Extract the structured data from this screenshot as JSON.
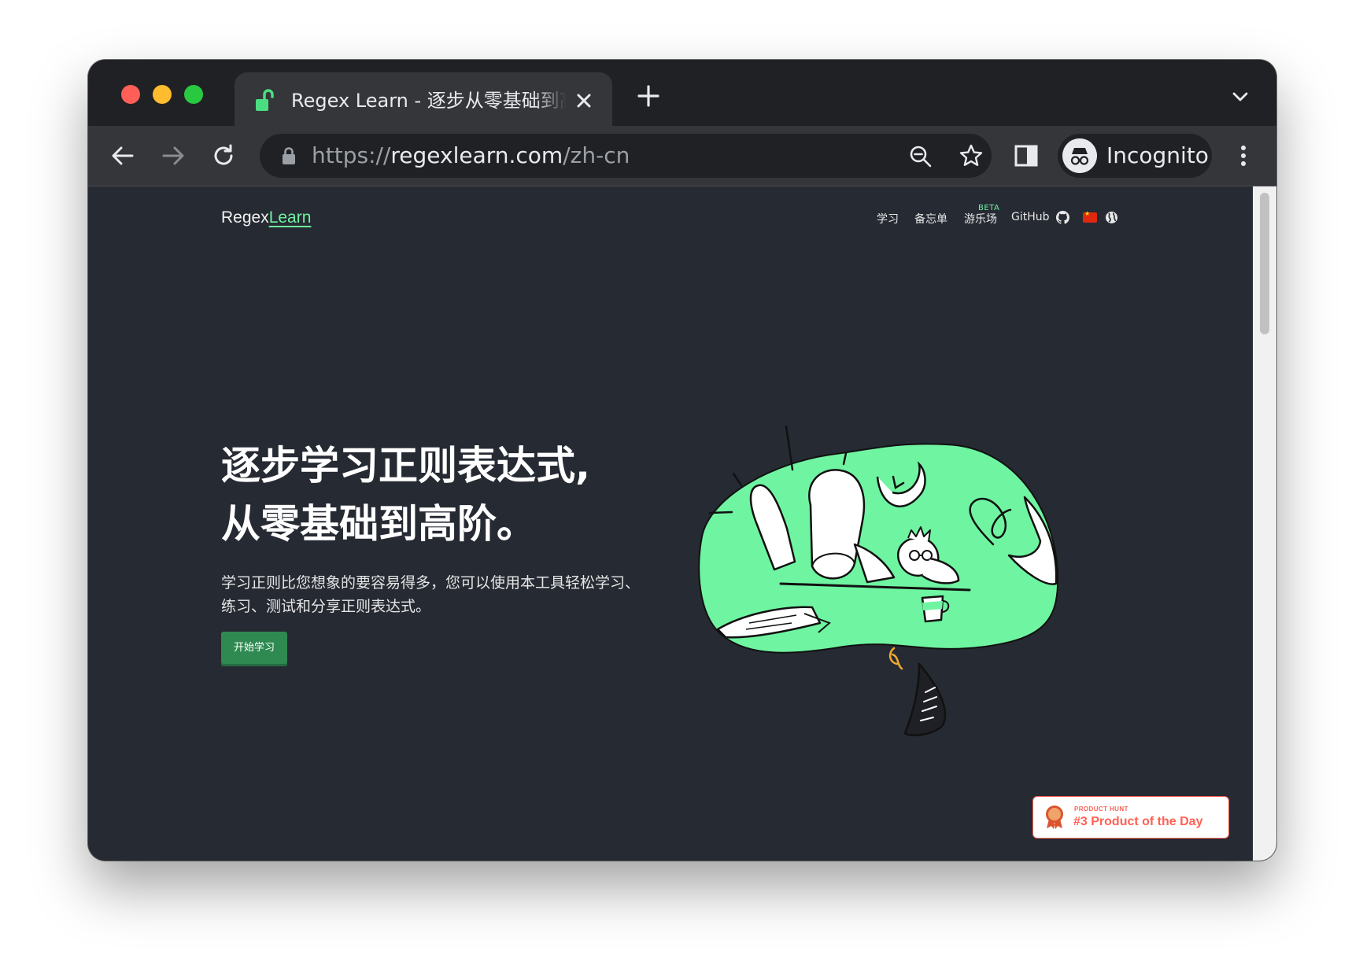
{
  "browser": {
    "tab_title": "Regex Learn - 逐步从零基础到高阶。",
    "url_scheme": "https://",
    "url_host": "regexlearn.com",
    "url_path": "/zh-cn",
    "profile_label": "Incognito"
  },
  "site": {
    "logo_prefix": "Regex",
    "logo_suffix": "Learn",
    "nav": {
      "learn": "学习",
      "cheatsheet": "备忘单",
      "playground": "游乐场",
      "playground_badge": "BETA",
      "github": "GitHub"
    }
  },
  "hero": {
    "title_line1": "逐步学习正则表达式,",
    "title_line2": "从零基础到高阶。",
    "description": "学习正则比您想象的要容易得多，您可以使用本工具轻松学习、练习、测试和分享正则表达式。",
    "cta": "开始学习"
  },
  "product_hunt": {
    "label": "PRODUCT HUNT",
    "rank_text": "#3 Product of the Day",
    "medal_number": "3"
  },
  "colors": {
    "accent": "#6ff4a1",
    "page_bg": "#262a33",
    "button": "#2f8a52",
    "product_hunt": "#ff6154"
  }
}
